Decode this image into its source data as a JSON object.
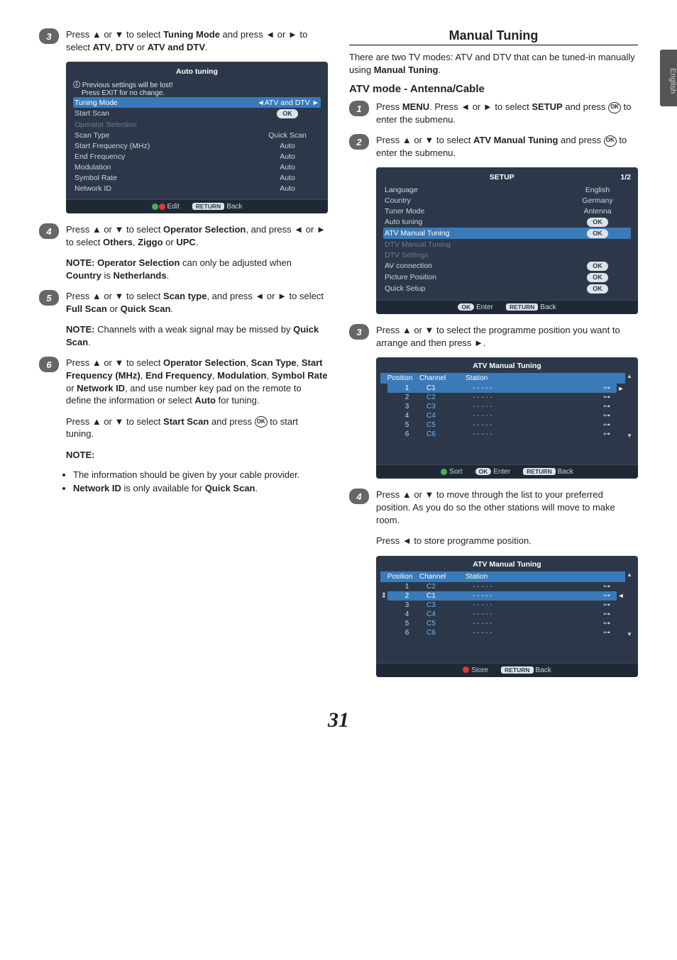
{
  "sideTab": "English",
  "pageNumber": "31",
  "left": {
    "step3": {
      "prefix": "Press ",
      "nav": " or ",
      "mid1": " to select ",
      "bold1": "Tuning Mode",
      "mid2": " and press ",
      "mid3": " or ",
      "mid4": " to select ",
      "bold2": "ATV",
      "comma": ", ",
      "bold3": "DTV",
      "or": " or ",
      "bold4": "ATV and DTV",
      "end": "."
    },
    "osd1": {
      "title": "Auto tuning",
      "warn1": "Previous settings will be lost!",
      "warn2": "Press EXIT for no change.",
      "rows": [
        {
          "label": "Tuning Mode",
          "value": "ATV and DTV",
          "hl": true,
          "arrows": true
        },
        {
          "label": "Start Scan",
          "value": "OK",
          "pill": true
        },
        {
          "label": "Operator Selection",
          "value": "",
          "dim": true
        },
        {
          "label": "Scan Type",
          "value": "Quick Scan"
        },
        {
          "label": "Start Frequency (MHz)",
          "value": "Auto"
        },
        {
          "label": "End Frequency",
          "value": "Auto"
        },
        {
          "label": "Modulation",
          "value": "Auto"
        },
        {
          "label": "Symbol Rate",
          "value": "Auto"
        },
        {
          "label": "Network ID",
          "value": "Auto"
        }
      ],
      "footer": {
        "edit": "Edit",
        "return": "RETURN",
        "back": "Back"
      }
    },
    "step4": {
      "prefix": "Press ",
      "mid1": " or ",
      "mid2": " to select ",
      "bold1": "Operator Selection",
      "mid3": ", and press ",
      "mid4": " or ",
      "mid5": " to select ",
      "bold2": "Others",
      "comma": ", ",
      "bold3": "Ziggo",
      "or": " or ",
      "bold4": "UPC",
      "end": "."
    },
    "note4": {
      "label": "NOTE:",
      "bold1": "Operator Selection",
      "text1": " can only be adjusted when ",
      "bold2": "Country",
      "text2": " is ",
      "bold3": "Netherlands",
      "end": "."
    },
    "step5": {
      "prefix": "Press ",
      "mid1": " or ",
      "mid2": " to select ",
      "bold1": "Scan type",
      "mid3": ", and press ",
      "mid4": " or ",
      "mid5": " to select ",
      "bold2": "Full Scan",
      "or": " or ",
      "bold3": "Quick Scan",
      "end": "."
    },
    "note5": {
      "label": "NOTE:",
      "text1": " Channels with a weak signal may be missed by ",
      "bold1": "Quick Scan",
      "end": "."
    },
    "step6a": {
      "prefix": "Press ",
      "mid1": " or ",
      "mid2": " to select ",
      "bold1": "Operator Selection",
      "c1": ", ",
      "bold2": "Scan Type",
      "c2": ", ",
      "bold3": "Start Frequency (MHz)",
      "c3": ", ",
      "bold4": "End Frequency",
      "c4": ", ",
      "bold5": "Modulation",
      "c5": ", ",
      "bold6": "Symbol Rate",
      "or": " or ",
      "bold7": "Network ID",
      "mid3": ", and use number key pad on the remote to define the information or select ",
      "bold8": "Auto",
      "end": " for tuning."
    },
    "step6b": {
      "prefix": "Press ",
      "mid1": " or ",
      "mid2": " to select ",
      "bold1": "Start Scan",
      "mid3": " and press ",
      "end": " to start tuning."
    },
    "note6": {
      "label": "NOTE:",
      "li1": "The information should be given by your cable provider.",
      "li2a": "Network ID",
      "li2b": " is only available for ",
      "li2c": "Quick Scan",
      "li2d": "."
    }
  },
  "right": {
    "heading": "Manual Tuning",
    "intro": {
      "t1": "There are two TV modes: ATV and DTV that can be tuned-in manually using ",
      "bold": "Manual Tuning",
      "end": "."
    },
    "subhead": "ATV mode - Antenna/Cable",
    "step1": {
      "prefix": "Press ",
      "bold1": "MENU",
      "mid1": ". Press ",
      "mid2": " or ",
      "mid3": " to select ",
      "bold2": "SETUP",
      "mid4": " and press ",
      "end": " to enter  the submenu."
    },
    "step2": {
      "prefix": "Press ",
      "mid1": " or ",
      "mid2": " to select ",
      "bold1": "ATV Manual Tuning",
      "mid3": " and press ",
      "end": " to enter the submenu."
    },
    "osd2": {
      "title": "SETUP",
      "page": "1/2",
      "rows": [
        {
          "label": "Language",
          "value": "English"
        },
        {
          "label": "Country",
          "value": "Germany"
        },
        {
          "label": "Tuner Mode",
          "value": "Antenna"
        },
        {
          "label": "Auto tuning",
          "value": "OK",
          "pill": true
        },
        {
          "label": "ATV Manual Tuning",
          "value": "OK",
          "pill": true,
          "hl": true
        },
        {
          "label": "DTV Manual Tuning",
          "value": "",
          "dim": true
        },
        {
          "label": "DTV Settings",
          "value": "",
          "dim": true
        },
        {
          "label": "AV connection",
          "value": "OK",
          "pill": true
        },
        {
          "label": "Picture Position",
          "value": "OK",
          "pill": true
        },
        {
          "label": "Quick Setup",
          "value": "OK",
          "pill": true
        }
      ],
      "footer": {
        "ok": "OK",
        "enter": "Enter",
        "return": "RETURN",
        "back": "Back"
      }
    },
    "step3": {
      "prefix": "Press ",
      "mid1": " or ",
      "mid2": " to select the programme position you want to arrange and then press ",
      "end": "."
    },
    "osd3": {
      "title": "ATV Manual Tuning",
      "cols": {
        "pos": "Position",
        "ch": "Channel",
        "st": "Station"
      },
      "rows": [
        {
          "pos": "1",
          "ch": "C1",
          "st": "- - - - -",
          "sel": true,
          "side": true
        },
        {
          "pos": "2",
          "ch": "C2",
          "st": "- - - - -"
        },
        {
          "pos": "3",
          "ch": "C3",
          "st": "- - - - -"
        },
        {
          "pos": "4",
          "ch": "C4",
          "st": "- - - - -"
        },
        {
          "pos": "5",
          "ch": "C5",
          "st": "- - - - -"
        },
        {
          "pos": "6",
          "ch": "C6",
          "st": "- - - - -"
        }
      ],
      "footer": {
        "sort": "Sort",
        "ok": "OK",
        "enter": "Enter",
        "return": "RETURN",
        "back": "Back"
      }
    },
    "step4a": {
      "prefix": "Press ",
      "mid1": " or ",
      "mid2": " to move through the list to your preferred position. As you do so the other stations will move to make room."
    },
    "step4b": {
      "prefix": "Press ",
      "end": " to store programme position."
    },
    "osd4": {
      "title": "ATV Manual Tuning",
      "cols": {
        "pos": "Position",
        "ch": "Channel",
        "st": "Station"
      },
      "rows": [
        {
          "pos": "1",
          "ch": "C2",
          "st": "- - - - -"
        },
        {
          "pos": "2",
          "ch": "C1",
          "st": "- - - - -",
          "sel": true,
          "updown": true,
          "side": true
        },
        {
          "pos": "3",
          "ch": "C3",
          "st": "- - - - -"
        },
        {
          "pos": "4",
          "ch": "C4",
          "st": "- - - - -"
        },
        {
          "pos": "5",
          "ch": "C5",
          "st": "- - - - -"
        },
        {
          "pos": "6",
          "ch": "C6",
          "st": "- - - - -"
        }
      ],
      "footer": {
        "store": "Store",
        "return": "RETURN",
        "back": "Back"
      }
    }
  }
}
